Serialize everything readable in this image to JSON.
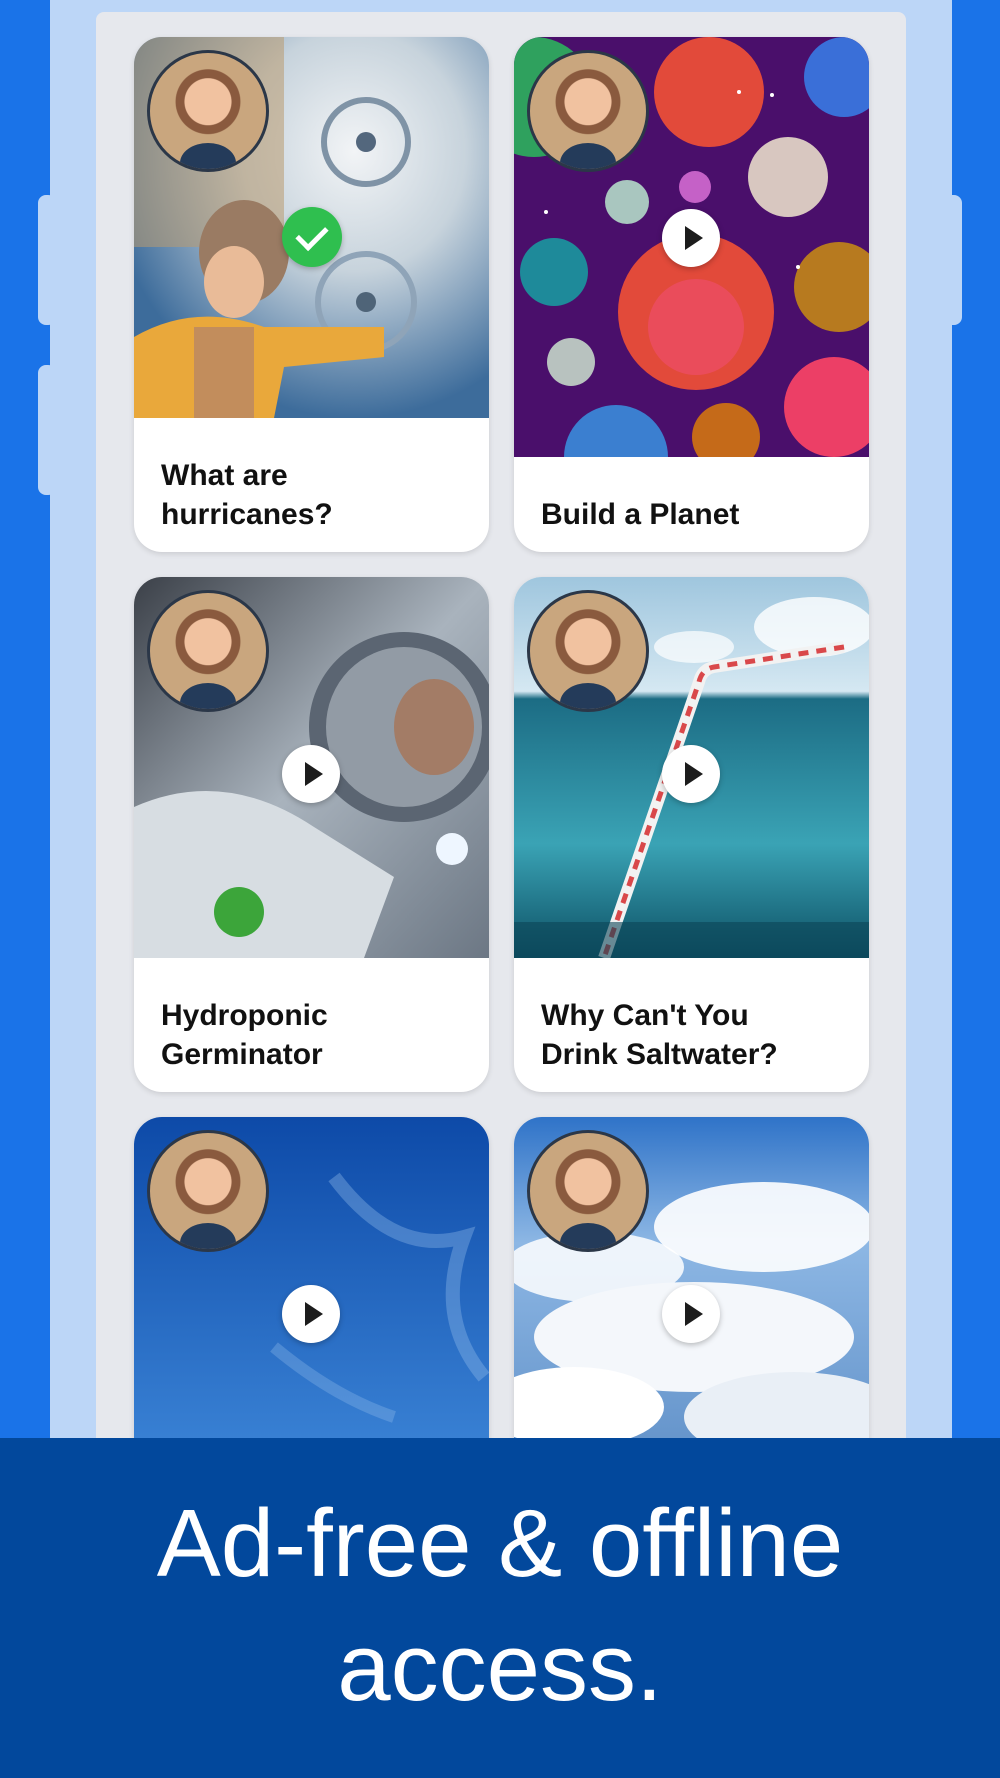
{
  "cards": [
    {
      "title": "What are\nhurricanes?",
      "status": "watched"
    },
    {
      "title": "Build a Planet",
      "status": "unwatched"
    },
    {
      "title": "Hydroponic\nGerminator",
      "status": "unwatched"
    },
    {
      "title": "Why Can't You\nDrink Saltwater?",
      "status": "unwatched"
    },
    {
      "title": "",
      "status": "unwatched"
    },
    {
      "title": "",
      "status": "unwatched"
    }
  ],
  "banner": {
    "text": "Ad-free & offline\naccess."
  },
  "colors": {
    "background": "#1a73e8",
    "banner": "#02489c",
    "watched_check": "#2fbf4f"
  },
  "icons": {
    "watched": "checkmark-icon",
    "unwatched": "play-icon"
  }
}
